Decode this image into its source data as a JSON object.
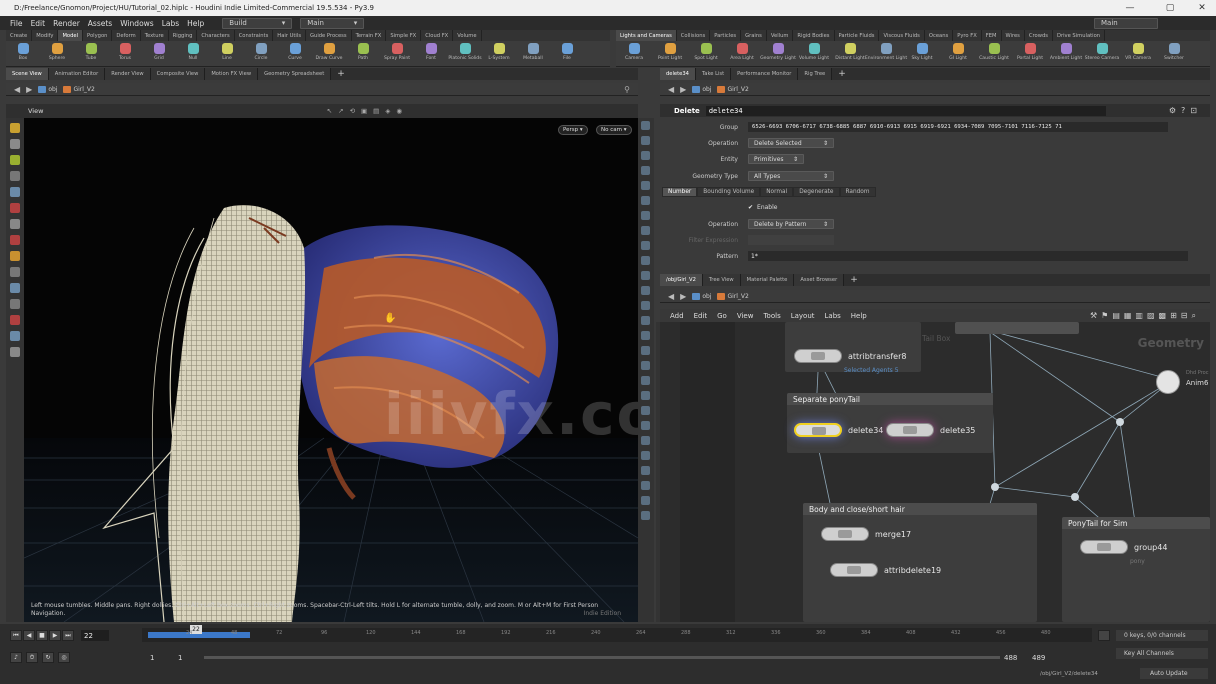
{
  "window": {
    "title": "D:/Freelance/Gnomon/Project/HU/Tutorial_02.hiplc - Houdini Indie Limited-Commercial 19.5.534 - Py3.9",
    "minimize": "—",
    "maximize": "▢",
    "close": "✕"
  },
  "menubar": {
    "items": [
      "File",
      "Edit",
      "Render",
      "Assets",
      "Windows",
      "Labs",
      "Help"
    ],
    "build_desktop": "Build",
    "main_desktop": "Main",
    "main_right": "Main"
  },
  "shelf_left": {
    "tabs": [
      "Create",
      "Modify",
      "Model",
      "Polygon",
      "Deform",
      "Texture",
      "Rigging",
      "Characters",
      "Constraints",
      "Hair Utils",
      "Guide Process",
      "Terrain FX",
      "Simple FX",
      "Cloud FX",
      "Volume"
    ],
    "active_tab": 2,
    "tools": [
      "Box",
      "Sphere",
      "Tube",
      "Torus",
      "Grid",
      "Null",
      "Line",
      "Circle",
      "Curve",
      "Draw Curve",
      "Path",
      "Spray Paint",
      "Font",
      "Platonic Solids",
      "L-System",
      "Metaball",
      "File"
    ]
  },
  "shelf_right": {
    "tabs": [
      "Lights and Cameras",
      "Collisions",
      "Particles",
      "Grains",
      "Vellum",
      "Rigid Bodies",
      "Particle Fluids",
      "Viscous Fluids",
      "Oceans",
      "Pyro FX",
      "FEM",
      "Wires",
      "Crowds",
      "Drive Simulation"
    ],
    "active_tab": 0,
    "tools": [
      "Camera",
      "Point Light",
      "Spot Light",
      "Area Light",
      "Geometry Light",
      "Volume Light",
      "Distant Light",
      "Environment Light",
      "Sky Light",
      "GI Light",
      "Caustic Light",
      "Portal Light",
      "Ambient Light",
      "Stereo Camera",
      "VR Camera",
      "Switcher"
    ]
  },
  "left_pane": {
    "tabs": [
      "Scene View",
      "Animation Editor",
      "Render View",
      "Composite View",
      "Motion FX View",
      "Geometry Spreadsheet"
    ],
    "active_tab": 0,
    "path_obj": "obj",
    "path_node": "Girl_V2",
    "view_label": "View",
    "persp_btn": "Persp ▾",
    "cam_btn": "No cam ▾",
    "help_line1": "Left mouse tumbles. Middle pans. Right dollies. Ctrl+Alt+Left box-zooms. Ctrl+Right zooms. Spacebar-Ctrl-Left tilts. Hold L for alternate tumble, dolly, and zoom.    M or Alt+M for First Person",
    "help_line2": "Navigation.",
    "indie_label": "Indie Edition"
  },
  "parm_pane": {
    "tabs": [
      "delete34",
      "Take List",
      "Performance Monitor",
      "Rig Tree"
    ],
    "active_tab": 0,
    "path_obj": "obj",
    "path_node": "Girl_V2",
    "node_type": "Delete",
    "node_name": "delete34",
    "group_label": "Group",
    "group_value": "6526-6693 6706-6717 6738-6885 6887 6910-6913 6915 6919-6921 6934-7089 7095-7101 7116-7125 71",
    "operation_label": "Operation",
    "operation_value": "Delete Selected",
    "entity_label": "Entity",
    "entity_value": "Primitives",
    "geotype_label": "Geometry Type",
    "geotype_value": "All Types",
    "subtabs": [
      "Number",
      "Bounding Volume",
      "Normal",
      "Degenerate",
      "Random"
    ],
    "active_subtab": 0,
    "enable_label": "Enable",
    "operation2_label": "Operation",
    "operation2_value": "Delete by Pattern",
    "filter_label": "Filter Expression",
    "pattern_label": "Pattern",
    "pattern_value": "1*"
  },
  "net_pane": {
    "tabs": [
      "/obj/Girl_V2",
      "Tree View",
      "Material Palette",
      "Asset Browser"
    ],
    "active_tab": 0,
    "path_obj": "obj",
    "path_node": "Girl_V2",
    "menu": [
      "Add",
      "Edit",
      "Go",
      "View",
      "Tools",
      "Layout",
      "Labs",
      "Help"
    ],
    "context_label": "Geometry",
    "boxes": {
      "separate": "Separate ponyTail",
      "body": "Body  and close/short hair",
      "ponytail": "PonyTail for Sim"
    },
    "nodes": {
      "attribtransfer": "attribtransfer8",
      "attribtransfer_sub": "Selected Agents 5",
      "delete34": "delete34",
      "delete35": "delete35",
      "merge": "merge17",
      "attribdelete": "attribdelete19",
      "group": "group44",
      "group_sub": "pony",
      "anim": "Anim6",
      "anim_sub": "Dhd Proc",
      "top_box_label": "Tail Box"
    }
  },
  "timeline": {
    "current_frame": "22",
    "start_frame": "1",
    "range_start": "1",
    "range_end": "488",
    "end_frame": "489",
    "marker": "22",
    "ticks": [
      "24",
      "48",
      "72",
      "96",
      "120",
      "144",
      "168",
      "192",
      "216",
      "240",
      "264",
      "288",
      "312",
      "336",
      "360",
      "384",
      "408",
      "432",
      "456",
      "480"
    ],
    "keys_label": "0 keys, 0/0 channels",
    "key_all": "Key All Channels",
    "path_label": "/obj/Girl_V2/delete34",
    "auto_update": "Auto Update"
  },
  "watermark": "iiivfx.com",
  "colors": {
    "accent": "#4a90d9",
    "titlebar": "#f0f0f0",
    "viewport_bg": "#050505",
    "hair_wire": "#e8e4cf",
    "hair_orange": "#c0602a",
    "hair_blue": "#3a4fa8"
  }
}
